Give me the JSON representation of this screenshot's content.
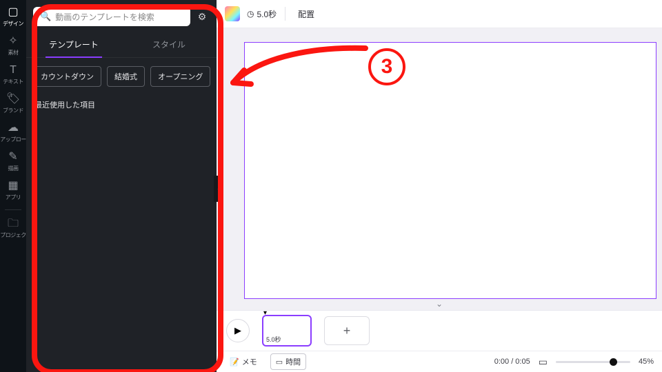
{
  "rail": {
    "items": [
      {
        "icon": "▢",
        "label": "デザイン",
        "active": true
      },
      {
        "icon": "✧",
        "label": "素材"
      },
      {
        "icon": "T",
        "label": "テキスト"
      },
      {
        "icon": "🏷",
        "label": "ブランド"
      },
      {
        "icon": "☁",
        "label": "アップロー"
      },
      {
        "icon": "✎",
        "label": "描画"
      },
      {
        "icon": "▦",
        "label": "アプリ"
      }
    ],
    "projects": {
      "icon": "🗀",
      "label": "プロジェク"
    }
  },
  "panel": {
    "search_placeholder": "動画のテンプレートを検索",
    "tabs": [
      {
        "label": "テンプレート",
        "active": true
      },
      {
        "label": "スタイル"
      }
    ],
    "chips": [
      "カウントダウン",
      "結婚式",
      "オープニング"
    ],
    "recent_title": "最近使用した項目"
  },
  "editor": {
    "duration": "5.0秒",
    "arrange": "配置",
    "clip_duration": "5.0秒",
    "add_label": "+"
  },
  "footer": {
    "memo": "メモ",
    "time_mode": "時間",
    "playhead": "0:00 / 0:05",
    "zoom": "45%"
  },
  "annotation": {
    "number": "3"
  },
  "colors": {
    "accent": "#8b3dff",
    "annotation": "#fb1610"
  }
}
